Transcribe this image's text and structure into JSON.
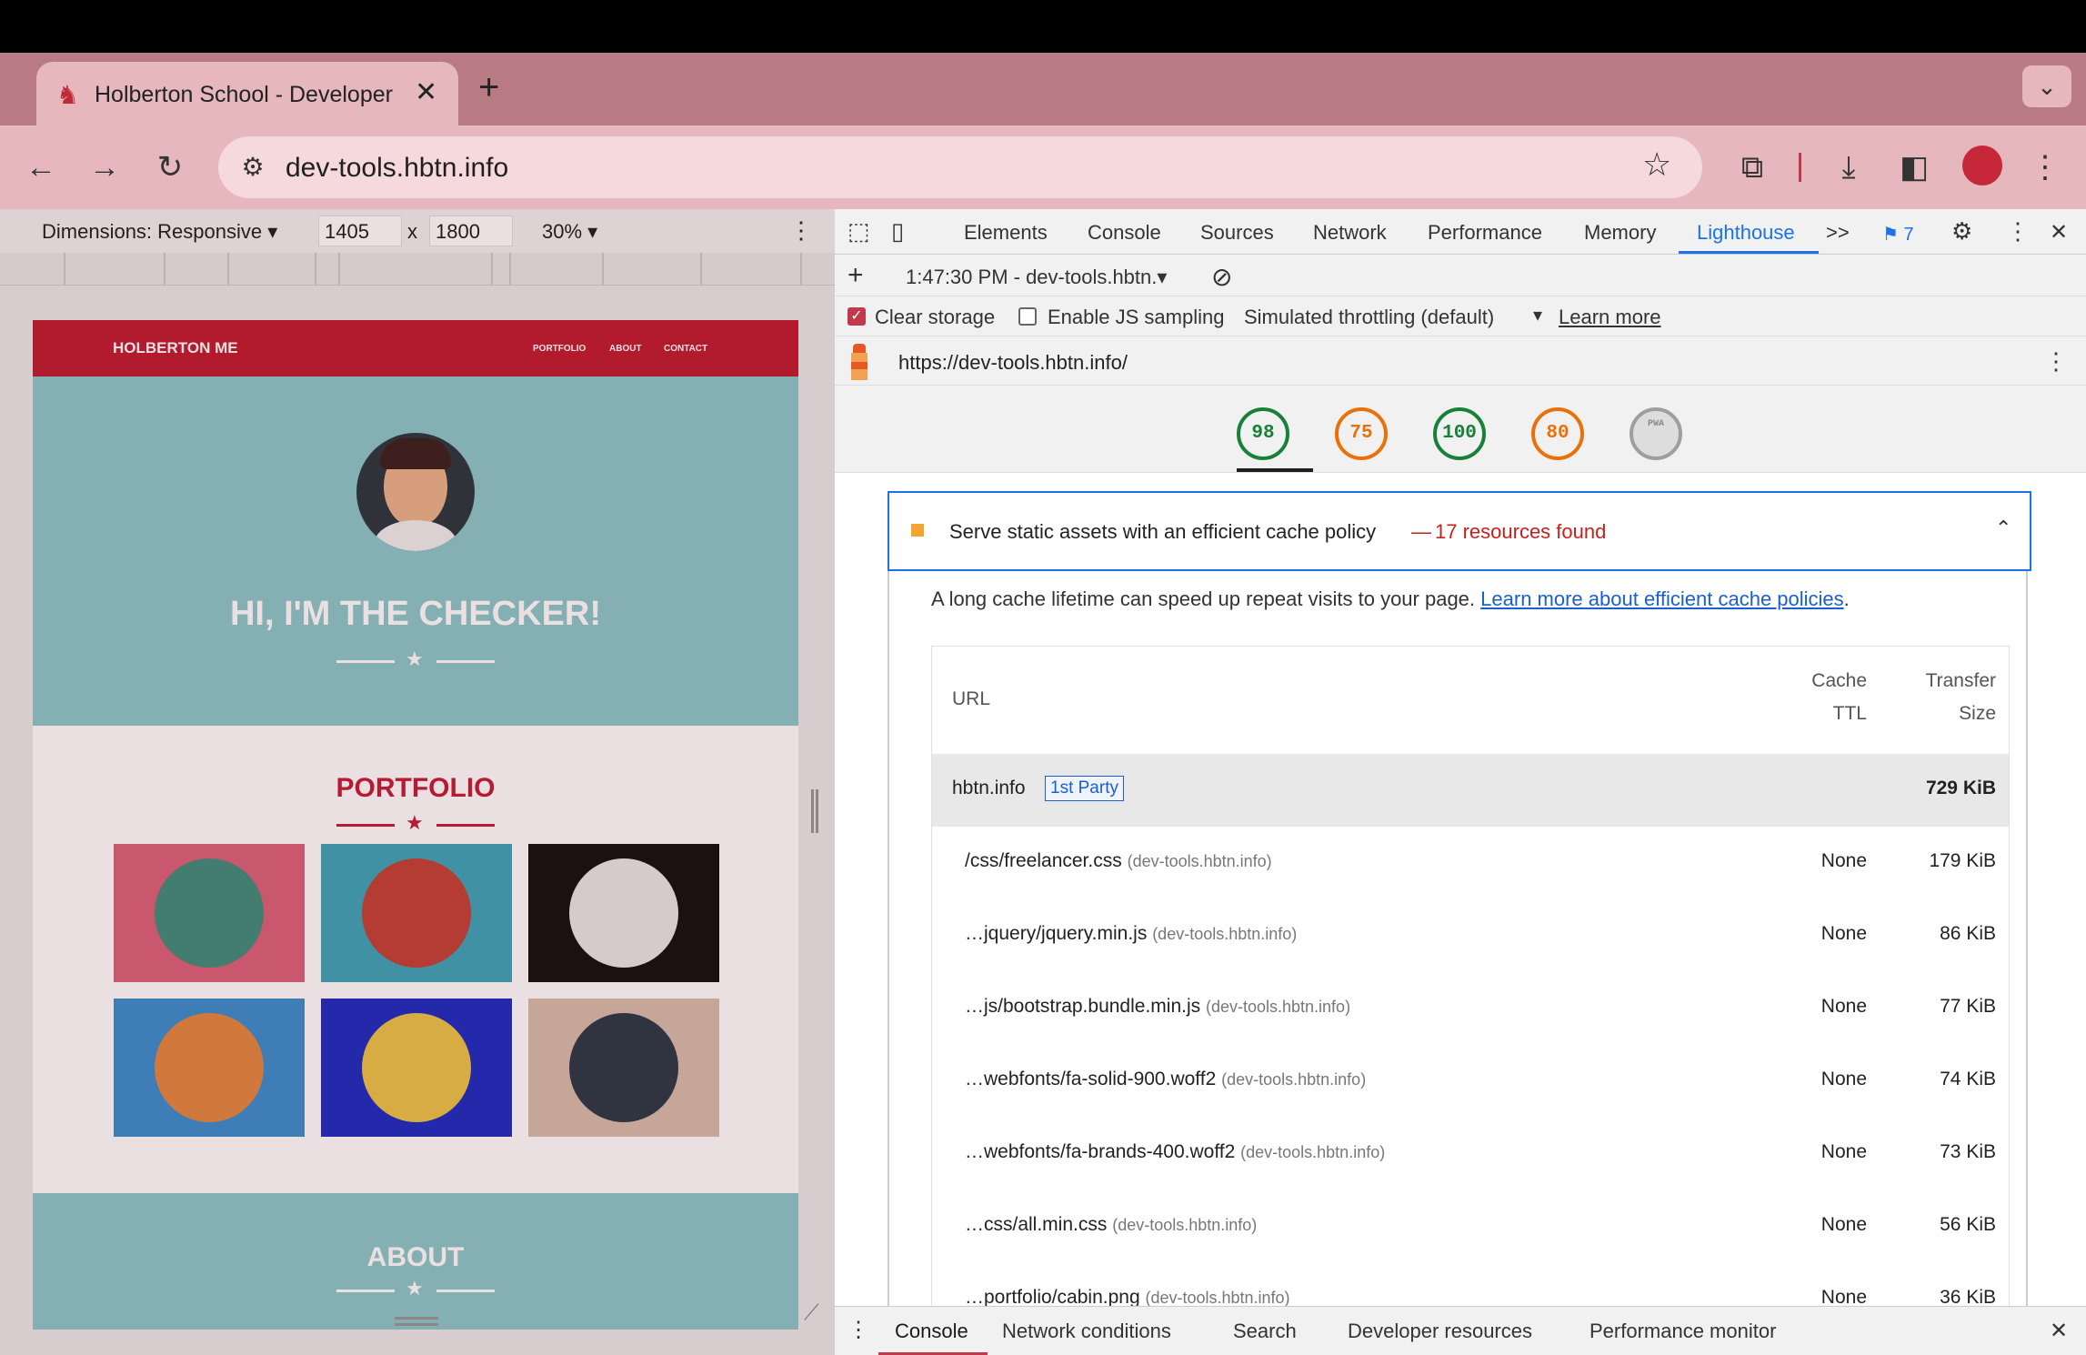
{
  "browser": {
    "tab_title": "Holberton School - Developer",
    "url": "dev-tools.hbtn.info"
  },
  "device_toolbar": {
    "dimensions_label": "Dimensions: Responsive",
    "width": "1405",
    "times": "x",
    "height": "1800",
    "zoom": "30%"
  },
  "site": {
    "brand": "HOLBERTON ME",
    "nav": [
      "PORTFOLIO",
      "ABOUT",
      "CONTACT"
    ],
    "hero_title": "HI, I'M THE CHECKER!",
    "portfolio_title": "PORTFOLIO",
    "about_title": "ABOUT",
    "portfolio_items": [
      {
        "name": "cabin",
        "bg": "#d9647b",
        "circle": "#3f8f7e"
      },
      {
        "name": "cake",
        "bg": "#3ea6bb",
        "circle": "#c2453a"
      },
      {
        "name": "circus",
        "bg": "#141414",
        "circle": "#e7e7e7"
      },
      {
        "name": "game",
        "bg": "#3b8fcf",
        "circle": "#e28a44"
      },
      {
        "name": "safe",
        "bg": "#1d2fc2",
        "circle": "#e9c44a"
      },
      {
        "name": "submarine",
        "bg": "#d5bdad",
        "circle": "#2b3b48"
      }
    ]
  },
  "devtools": {
    "tabs": [
      "Elements",
      "Console",
      "Sources",
      "Network",
      "Performance",
      "Memory",
      "Lighthouse"
    ],
    "active_tab": "Lighthouse",
    "more": ">>",
    "issues_count": "7",
    "report_time": "1:47:30 PM - dev-tools.hbtn.",
    "clear_storage": "Clear storage",
    "enable_js_sampling": "Enable JS sampling",
    "throttling": "Simulated throttling (default)",
    "learn_more": "Learn more",
    "page_url": "https://dev-tools.hbtn.info/",
    "scores": [
      {
        "value": "98",
        "color": "#188038"
      },
      {
        "value": "75",
        "color": "#e8710a"
      },
      {
        "value": "100",
        "color": "#188038"
      },
      {
        "value": "80",
        "color": "#e8710a"
      },
      {
        "value": "PWA",
        "color": "#9e9e9e"
      }
    ],
    "audit": {
      "title": "Serve static assets with an efficient cache policy",
      "dash": "—",
      "found": "17 resources found",
      "desc": "A long cache lifetime can speed up repeat visits to your page.",
      "desc_link": "Learn more about efficient cache policies",
      "desc_end": ".",
      "col_url": "URL",
      "col_ttl_1": "Cache",
      "col_ttl_2": "TTL",
      "col_size_1": "Transfer",
      "col_size_2": "Size",
      "group_host": "hbtn.info",
      "group_badge": "1st Party",
      "group_size": "729 KiB",
      "rows": [
        {
          "file": "/css/freelancer.css",
          "host": "(dev-tools.hbtn.info)",
          "ttl": "None",
          "size": "179 KiB"
        },
        {
          "file": "…jquery/jquery.min.js",
          "host": "(dev-tools.hbtn.info)",
          "ttl": "None",
          "size": "86 KiB"
        },
        {
          "file": "…js/bootstrap.bundle.min.js",
          "host": "(dev-tools.hbtn.info)",
          "ttl": "None",
          "size": "77 KiB"
        },
        {
          "file": "…webfonts/fa-solid-900.woff2",
          "host": "(dev-tools.hbtn.info)",
          "ttl": "None",
          "size": "74 KiB"
        },
        {
          "file": "…webfonts/fa-brands-400.woff2",
          "host": "(dev-tools.hbtn.info)",
          "ttl": "None",
          "size": "73 KiB"
        },
        {
          "file": "…css/all.min.css",
          "host": "(dev-tools.hbtn.info)",
          "ttl": "None",
          "size": "56 KiB"
        },
        {
          "file": "…portfolio/cabin.png",
          "host": "(dev-tools.hbtn.info)",
          "ttl": "None",
          "size": "36 KiB"
        }
      ]
    },
    "drawer_tabs": [
      "Console",
      "Network conditions",
      "Search",
      "Developer resources",
      "Performance monitor"
    ]
  }
}
